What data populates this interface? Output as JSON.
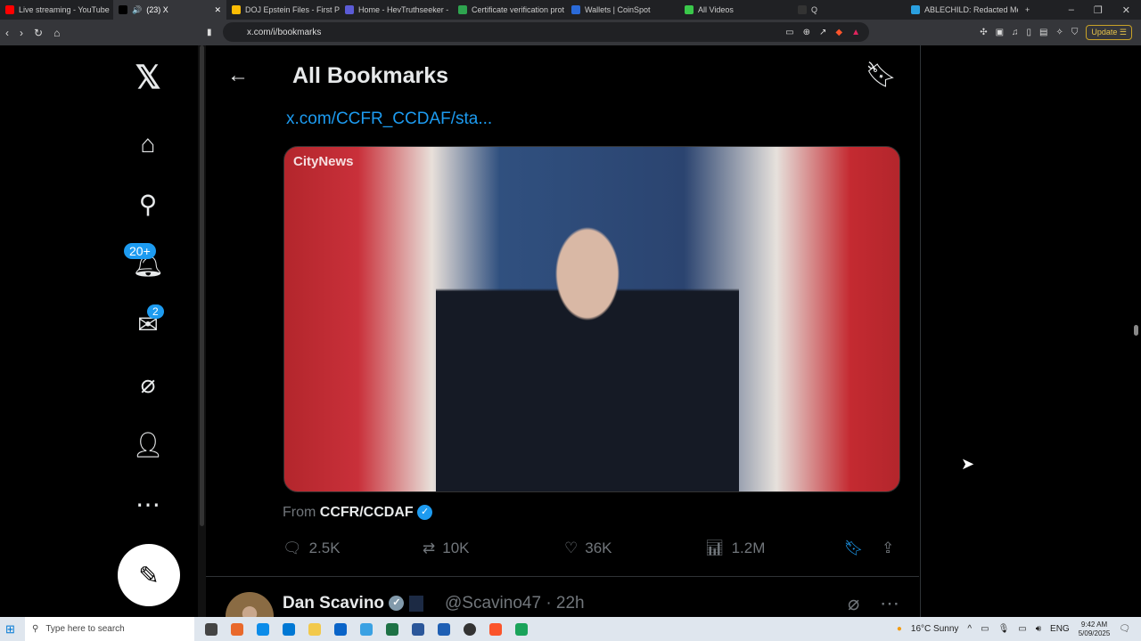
{
  "browser": {
    "tabs": [
      {
        "label": "Live streaming - YouTube",
        "color": "#ff0000"
      },
      {
        "label": "(23) X",
        "color": "#000000",
        "active": true,
        "audio": "🔊"
      },
      {
        "label": "DOJ Epstein Files - First Ph",
        "color": "#fbbc04"
      },
      {
        "label": "Home - HevTruthseeker -",
        "color": "#5b5bd6"
      },
      {
        "label": "Certificate verification prot",
        "color": "#2ea44f"
      },
      {
        "label": "Wallets | CoinSpot",
        "color": "#2a6ad8"
      },
      {
        "label": "All Videos",
        "color": "#3ac84a"
      },
      {
        "label": "Q",
        "color": "#333333"
      },
      {
        "label": "ABLECHILD: Redacted Me",
        "color": "#2aa0e0"
      }
    ],
    "new_tab": "+",
    "url": "x.com/i/bookmarks",
    "update_label": "Update"
  },
  "sidebar": {
    "notifications_badge": "20+",
    "messages_badge": "2"
  },
  "header": {
    "title": "All Bookmarks"
  },
  "tweet": {
    "link": "x.com/CCFR_CCDAF/sta...",
    "video_watermark": "CityNews",
    "from_label": "From",
    "from_account": "CCFR/CCDAF",
    "replies": "2.5K",
    "reposts": "10K",
    "likes": "36K",
    "views": "1.2M",
    "bookmarked": true
  },
  "next_tweet": {
    "name": "Dan Scavino",
    "handle": "@Scavino47",
    "time": "· 22h"
  },
  "taskbar": {
    "search_placeholder": "Type here to search",
    "weather": "16°C  Sunny",
    "lang": "ENG",
    "time": "9:42 AM",
    "date": "5/09/2025"
  }
}
